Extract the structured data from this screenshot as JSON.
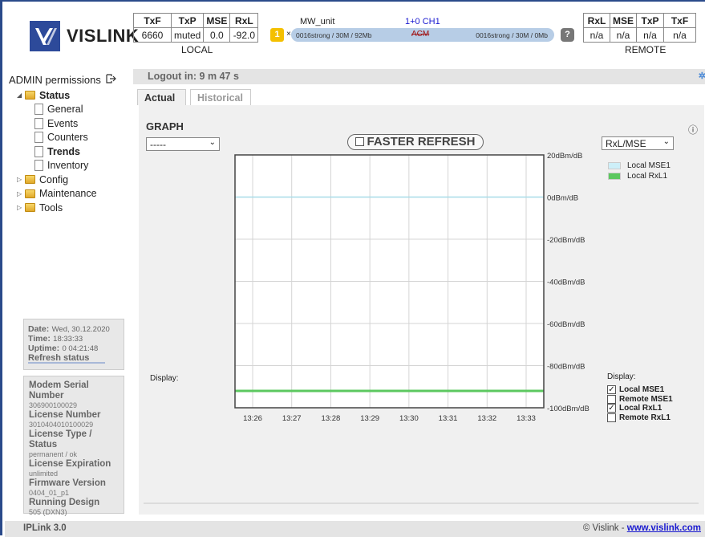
{
  "brand": {
    "name": "VISLINK"
  },
  "local": {
    "headers": [
      "TxF",
      "TxP",
      "MSE",
      "RxL"
    ],
    "values": [
      "6660",
      "muted",
      "0.0",
      "-92.0"
    ],
    "caption": "LOCAL"
  },
  "remote": {
    "headers": [
      "RxL",
      "MSE",
      "TxP",
      "TxF"
    ],
    "values": [
      "n/a",
      "n/a",
      "n/a",
      "n/a"
    ],
    "caption": "REMOTE"
  },
  "link": {
    "unit": "MW_unit",
    "channel": "1+0 CH1",
    "count": "1",
    "multiplier": "×",
    "left_text": "0016strong / 30M / 92Mb",
    "mode": "ACM",
    "right_text": "0016strong / 30M / 0Mb",
    "help": "?"
  },
  "sidebar": {
    "admin_label": "ADMIN permissions",
    "tree": {
      "status": "Status",
      "general": "General",
      "events": "Events",
      "counters": "Counters",
      "trends": "Trends",
      "inventory": "Inventory",
      "config": "Config",
      "maintenance": "Maintenance",
      "tools": "Tools"
    },
    "info": {
      "date_label": "Date:",
      "date_value": "Wed, 30.12.2020",
      "time_label": "Time:",
      "time_value": "18:33:33",
      "uptime_label": "Uptime:",
      "uptime_value": "0 04:21:48",
      "refresh_label": "Refresh status"
    },
    "license": {
      "serial_label": "Modem Serial Number",
      "serial_value": "306900100029",
      "number_label": "License Number",
      "number_value": "3010404010100029",
      "type_label": "License Type / Status",
      "type_value": "permanent / ok",
      "expiration_label": "License Expiration",
      "expiration_value": "unlimited",
      "firmware_label": "Firmware Version",
      "firmware_value": "0404_01_p1",
      "design_label": "Running Design",
      "design_value": "505 (DXN3)"
    }
  },
  "main": {
    "logout_text": "Logout in: 9 m 47 s",
    "tabs": {
      "actual": "Actual",
      "historical": "Historical"
    },
    "graph_title": "GRAPH",
    "left_select": "-----",
    "right_select": "RxL/MSE",
    "faster_refresh": "FASTER REFRESH",
    "display_left": "Display:",
    "display_right": "Display:",
    "legend": [
      {
        "label": "Local MSE1",
        "color": "#cdeff8"
      },
      {
        "label": "Local RxL1",
        "color": "#5cc860"
      }
    ],
    "display_checks": [
      {
        "label": "Local MSE1",
        "checked": true
      },
      {
        "label": "Remote MSE1",
        "checked": false
      },
      {
        "label": "Local RxL1",
        "checked": true
      },
      {
        "label": "Remote RxL1",
        "checked": false
      }
    ]
  },
  "chart_data": {
    "type": "line",
    "x": [
      "13:26",
      "13:27",
      "13:28",
      "13:29",
      "13:30",
      "13:31",
      "13:32",
      "13:33"
    ],
    "y_ticks": [
      "20dBm/dB",
      "0dBm/dB",
      "-20dBm/dB",
      "-40dBm/dB",
      "-60dBm/dB",
      "-80dBm/dB",
      "-100dBm/dB"
    ],
    "ylim": [
      -100,
      20
    ],
    "grid": true,
    "series": [
      {
        "name": "Local MSE1",
        "color": "#a8dce8",
        "values": [
          0,
          0,
          0,
          0,
          0,
          0,
          0,
          0
        ]
      },
      {
        "name": "Local RxL1",
        "color": "#5cc860",
        "values": [
          -92,
          -92,
          -92,
          -92,
          -92,
          -92,
          -92,
          -92
        ]
      }
    ]
  },
  "footer": {
    "version": "IPLink 3.0",
    "copyright": "© Vislink - ",
    "link": "www.vislink.com"
  }
}
